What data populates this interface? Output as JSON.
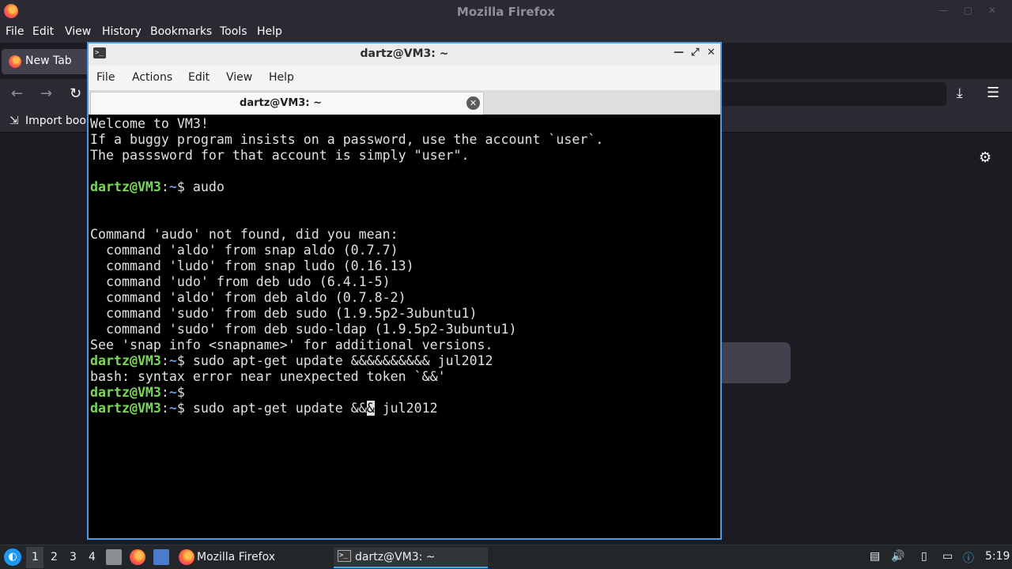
{
  "firefox": {
    "window_title": "Mozilla Firefox",
    "menu": [
      "File",
      "Edit",
      "View",
      "History",
      "Bookmarks",
      "Tools",
      "Help"
    ],
    "tab_label": "New Tab",
    "bookmarks_label": "Import book"
  },
  "terminal": {
    "window_title": "dartz@VM3: ~",
    "menu": [
      "File",
      "Actions",
      "Edit",
      "View",
      "Help"
    ],
    "tab_label": "dartz@VM3: ~",
    "prompt": {
      "user": "dartz@VM3",
      "colon": ":",
      "path": "~",
      "sign": "$ "
    },
    "lines": [
      {
        "type": "text",
        "text": "Welcome to VM3!"
      },
      {
        "type": "text",
        "text": "If a buggy program insists on a password, use the account `user`."
      },
      {
        "type": "text",
        "text": "The passsword for that account is simply \"user\"."
      },
      {
        "type": "blank",
        "text": ""
      },
      {
        "type": "prompt",
        "cmd": "audo"
      },
      {
        "type": "blank",
        "text": ""
      },
      {
        "type": "blank",
        "text": ""
      },
      {
        "type": "text",
        "text": "Command 'audo' not found, did you mean:"
      },
      {
        "type": "text",
        "text": "  command 'aldo' from snap aldo (0.7.7)"
      },
      {
        "type": "text",
        "text": "  command 'ludo' from snap ludo (0.16.13)"
      },
      {
        "type": "text",
        "text": "  command 'udo' from deb udo (6.4.1-5)"
      },
      {
        "type": "text",
        "text": "  command 'aldo' from deb aldo (0.7.8-2)"
      },
      {
        "type": "text",
        "text": "  command 'sudo' from deb sudo (1.9.5p2-3ubuntu1)"
      },
      {
        "type": "text",
        "text": "  command 'sudo' from deb sudo-ldap (1.9.5p2-3ubuntu1)"
      },
      {
        "type": "text",
        "text": "See 'snap info <snapname>' for additional versions."
      },
      {
        "type": "prompt",
        "cmd": "sudo apt-get update &&&&&&&&&& jul2012"
      },
      {
        "type": "text",
        "text": "bash: syntax error near unexpected token `&&'"
      },
      {
        "type": "prompt",
        "cmd": ""
      },
      {
        "type": "prompt_cursor",
        "cmd_before": "sudo apt-get update &&",
        "cursor_char": "&",
        "cmd_after": " jul2012"
      }
    ]
  },
  "taskbar": {
    "workspaces": [
      "1",
      "2",
      "3",
      "4"
    ],
    "active_workspace": "1",
    "tasks": [
      {
        "label": "Mozilla Firefox",
        "icon": "firefox-icon"
      },
      {
        "label": "dartz@VM3: ~",
        "icon": "terminal-icon"
      }
    ],
    "clock": "5:19"
  },
  "colors": {
    "terminal_border": "#4b9ee6",
    "prompt_user": "#7ad75a",
    "prompt_path": "#6e9bd8",
    "taskbar_accent": "#3daee9"
  }
}
